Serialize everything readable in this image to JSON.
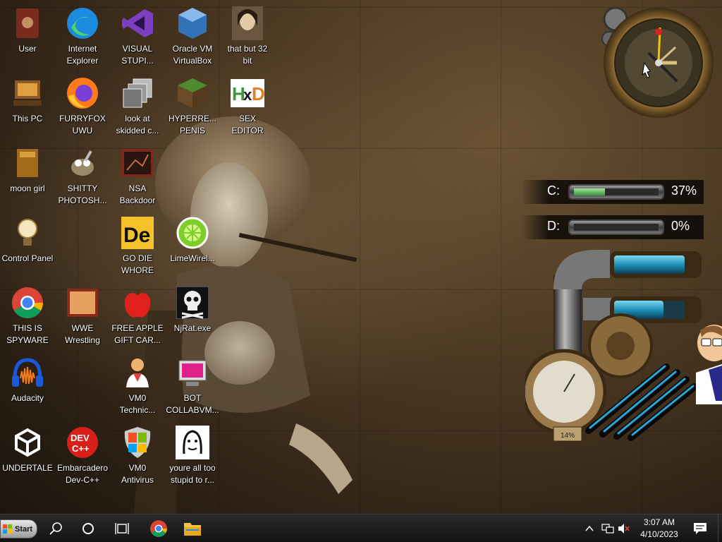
{
  "desktop": {
    "icons": [
      {
        "label": "User"
      },
      {
        "label": "Internet\nExplorer"
      },
      {
        "label": "VISUAL\nSTUPI..."
      },
      {
        "label": "Oracle VM\nVirtualBox"
      },
      {
        "label": "that but 32\nbit"
      },
      {
        "label": "This PC"
      },
      {
        "label": "FURRYFOX\nUWU"
      },
      {
        "label": "look at\nskidded c..."
      },
      {
        "label": "HYPERRE...\nPENIS"
      },
      {
        "label": "SEX\nEDITOR"
      },
      {
        "label": "moon girl"
      },
      {
        "label": "SHITTY\nPHOTOSH..."
      },
      {
        "label": "NSA\nBackdoor"
      },
      {
        "label": "Control Panel"
      },
      {
        "label": "GO DIE\nWHORE"
      },
      {
        "label": "LimeWirel..."
      },
      {
        "label": "THIS IS\nSPYWARE"
      },
      {
        "label": "WWE\nWrestling"
      },
      {
        "label": "FREE APPLE\nGIFT CAR..."
      },
      {
        "label": "NjRat.exe"
      },
      {
        "label": "Audacity"
      },
      {
        "label": "VM0\nTechnic..."
      },
      {
        "label": "BOT\nCOLLABVM..."
      },
      {
        "label": "UNDERTALE"
      },
      {
        "label": "Embarcadero\nDev-C++"
      },
      {
        "label": "VM0\nAntivirus"
      },
      {
        "label": "youre all too\nstupid to r..."
      }
    ]
  },
  "gadgets": {
    "drives": [
      {
        "letter": "C:",
        "percent_text": "37%",
        "used_fraction": 0.37
      },
      {
        "letter": "D:",
        "percent_text": "0%",
        "used_fraction": 0.0
      }
    ],
    "gauge_reading": "14%"
  },
  "taskbar": {
    "start_label": "Start",
    "time": "3:07 AM",
    "date": "4/10/2023"
  }
}
